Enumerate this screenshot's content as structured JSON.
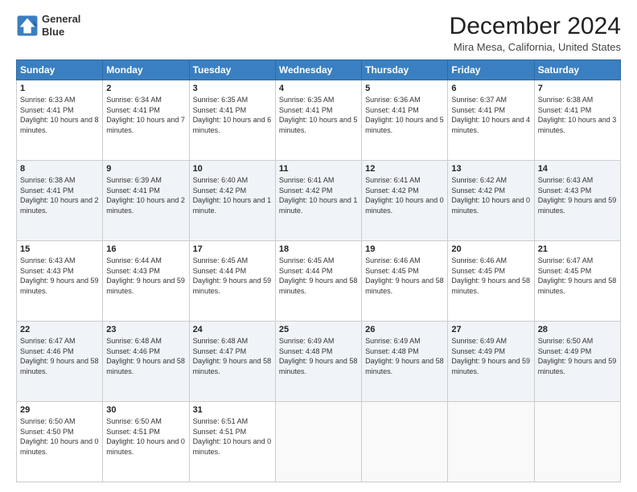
{
  "header": {
    "logo_line1": "General",
    "logo_line2": "Blue",
    "title": "December 2024",
    "subtitle": "Mira Mesa, California, United States"
  },
  "weekdays": [
    "Sunday",
    "Monday",
    "Tuesday",
    "Wednesday",
    "Thursday",
    "Friday",
    "Saturday"
  ],
  "weeks": [
    [
      {
        "day": "1",
        "sunrise": "6:33 AM",
        "sunset": "4:41 PM",
        "daylight": "10 hours and 8 minutes."
      },
      {
        "day": "2",
        "sunrise": "6:34 AM",
        "sunset": "4:41 PM",
        "daylight": "10 hours and 7 minutes."
      },
      {
        "day": "3",
        "sunrise": "6:35 AM",
        "sunset": "4:41 PM",
        "daylight": "10 hours and 6 minutes."
      },
      {
        "day": "4",
        "sunrise": "6:35 AM",
        "sunset": "4:41 PM",
        "daylight": "10 hours and 5 minutes."
      },
      {
        "day": "5",
        "sunrise": "6:36 AM",
        "sunset": "4:41 PM",
        "daylight": "10 hours and 5 minutes."
      },
      {
        "day": "6",
        "sunrise": "6:37 AM",
        "sunset": "4:41 PM",
        "daylight": "10 hours and 4 minutes."
      },
      {
        "day": "7",
        "sunrise": "6:38 AM",
        "sunset": "4:41 PM",
        "daylight": "10 hours and 3 minutes."
      }
    ],
    [
      {
        "day": "8",
        "sunrise": "6:38 AM",
        "sunset": "4:41 PM",
        "daylight": "10 hours and 2 minutes."
      },
      {
        "day": "9",
        "sunrise": "6:39 AM",
        "sunset": "4:41 PM",
        "daylight": "10 hours and 2 minutes."
      },
      {
        "day": "10",
        "sunrise": "6:40 AM",
        "sunset": "4:42 PM",
        "daylight": "10 hours and 1 minute."
      },
      {
        "day": "11",
        "sunrise": "6:41 AM",
        "sunset": "4:42 PM",
        "daylight": "10 hours and 1 minute."
      },
      {
        "day": "12",
        "sunrise": "6:41 AM",
        "sunset": "4:42 PM",
        "daylight": "10 hours and 0 minutes."
      },
      {
        "day": "13",
        "sunrise": "6:42 AM",
        "sunset": "4:42 PM",
        "daylight": "10 hours and 0 minutes."
      },
      {
        "day": "14",
        "sunrise": "6:43 AM",
        "sunset": "4:43 PM",
        "daylight": "9 hours and 59 minutes."
      }
    ],
    [
      {
        "day": "15",
        "sunrise": "6:43 AM",
        "sunset": "4:43 PM",
        "daylight": "9 hours and 59 minutes."
      },
      {
        "day": "16",
        "sunrise": "6:44 AM",
        "sunset": "4:43 PM",
        "daylight": "9 hours and 59 minutes."
      },
      {
        "day": "17",
        "sunrise": "6:45 AM",
        "sunset": "4:44 PM",
        "daylight": "9 hours and 59 minutes."
      },
      {
        "day": "18",
        "sunrise": "6:45 AM",
        "sunset": "4:44 PM",
        "daylight": "9 hours and 58 minutes."
      },
      {
        "day": "19",
        "sunrise": "6:46 AM",
        "sunset": "4:45 PM",
        "daylight": "9 hours and 58 minutes."
      },
      {
        "day": "20",
        "sunrise": "6:46 AM",
        "sunset": "4:45 PM",
        "daylight": "9 hours and 58 minutes."
      },
      {
        "day": "21",
        "sunrise": "6:47 AM",
        "sunset": "4:45 PM",
        "daylight": "9 hours and 58 minutes."
      }
    ],
    [
      {
        "day": "22",
        "sunrise": "6:47 AM",
        "sunset": "4:46 PM",
        "daylight": "9 hours and 58 minutes."
      },
      {
        "day": "23",
        "sunrise": "6:48 AM",
        "sunset": "4:46 PM",
        "daylight": "9 hours and 58 minutes."
      },
      {
        "day": "24",
        "sunrise": "6:48 AM",
        "sunset": "4:47 PM",
        "daylight": "9 hours and 58 minutes."
      },
      {
        "day": "25",
        "sunrise": "6:49 AM",
        "sunset": "4:48 PM",
        "daylight": "9 hours and 58 minutes."
      },
      {
        "day": "26",
        "sunrise": "6:49 AM",
        "sunset": "4:48 PM",
        "daylight": "9 hours and 58 minutes."
      },
      {
        "day": "27",
        "sunrise": "6:49 AM",
        "sunset": "4:49 PM",
        "daylight": "9 hours and 59 minutes."
      },
      {
        "day": "28",
        "sunrise": "6:50 AM",
        "sunset": "4:49 PM",
        "daylight": "9 hours and 59 minutes."
      }
    ],
    [
      {
        "day": "29",
        "sunrise": "6:50 AM",
        "sunset": "4:50 PM",
        "daylight": "10 hours and 0 minutes."
      },
      {
        "day": "30",
        "sunrise": "6:50 AM",
        "sunset": "4:51 PM",
        "daylight": "10 hours and 0 minutes."
      },
      {
        "day": "31",
        "sunrise": "6:51 AM",
        "sunset": "4:51 PM",
        "daylight": "10 hours and 0 minutes."
      },
      null,
      null,
      null,
      null
    ]
  ],
  "labels": {
    "sunrise": "Sunrise:",
    "sunset": "Sunset:",
    "daylight": "Daylight:"
  }
}
